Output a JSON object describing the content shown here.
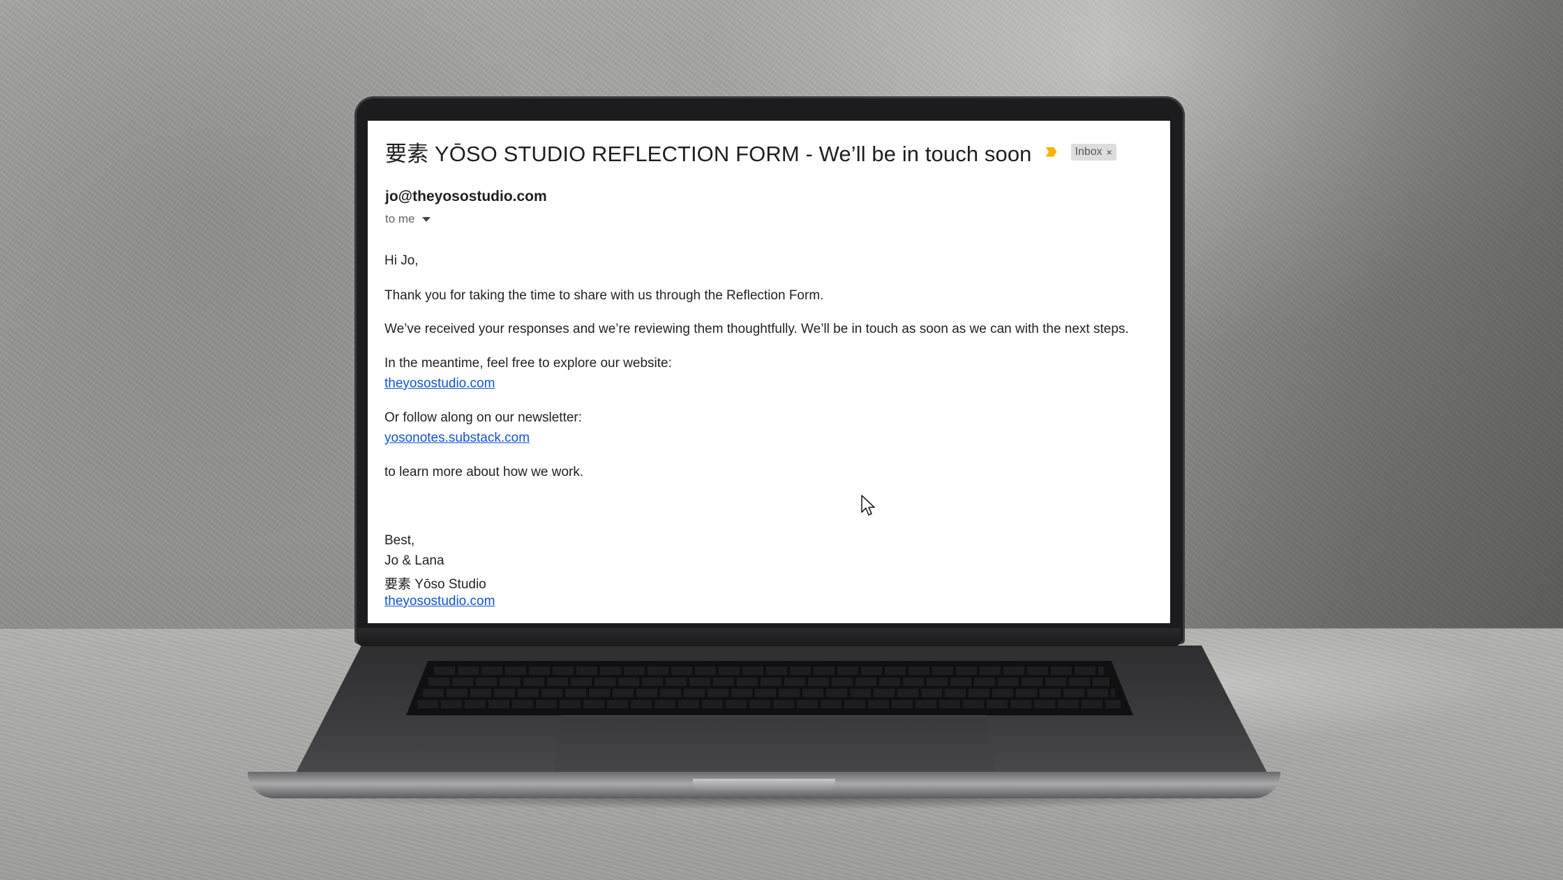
{
  "email": {
    "subject": "要素 YŌSO STUDIO REFLECTION FORM - We’ll be in touch soon",
    "label": "Inbox",
    "label_remove": "×",
    "sender": "jo@theyosostudio.com",
    "recipient": "to me",
    "body": {
      "greeting": "Hi Jo,",
      "p1": "Thank you for taking the time to share with us through the Reflection Form.",
      "p2": "We’ve received your responses and we’re reviewing them thoughtfully. We’ll be in touch as soon as we can with the next steps.",
      "p3": "In the meantime, feel free to explore our website:",
      "link1": "theyosostudio.com",
      "p4": "Or follow along on our newsletter:",
      "link2": "yosonotes.substack.com",
      "p5": "to learn more about how we work.",
      "signoff": "Best,",
      "names": "Jo & Lana",
      "studio": "要素 Yōso Studio",
      "link3": "theyosostudio.com"
    }
  },
  "icons": {
    "important": "important-marker-icon",
    "caret": "chevron-down-icon",
    "cursor": "mouse-pointer-icon"
  },
  "colors": {
    "link": "#1155cc",
    "important_marker": "#f4b400",
    "label_chip": "#dddddd"
  }
}
